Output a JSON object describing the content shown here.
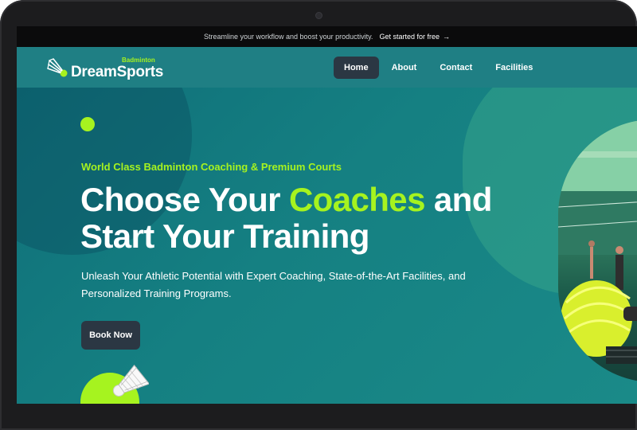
{
  "topbar": {
    "message": "Streamline your workflow and boost your productivity.",
    "cta": "Get started for free",
    "arrow": "→"
  },
  "brand": {
    "small": "Badminton",
    "main": "DreamSports",
    "icon": "shuttlecock-icon"
  },
  "nav": {
    "items": [
      {
        "label": "Home",
        "active": true
      },
      {
        "label": "About"
      },
      {
        "label": "Contact"
      },
      {
        "label": "Facilities"
      }
    ]
  },
  "hero": {
    "eyebrow": "World Class Badminton Coaching & Premium Courts",
    "headline_part1": "Choose Your ",
    "headline_accent": "Coaches",
    "headline_part2": " and",
    "headline_line2": "Start Your Training",
    "subtext": "Unleash Your Athletic Potential with Expert Coaching, State-of-the-Art Facilities, and Personalized Training Programs.",
    "cta": "Book Now"
  },
  "colors": {
    "accent": "#a6f31f",
    "header_bg": "#1f7f84",
    "button_bg": "#2b3743",
    "hero_bg": "#158082"
  }
}
